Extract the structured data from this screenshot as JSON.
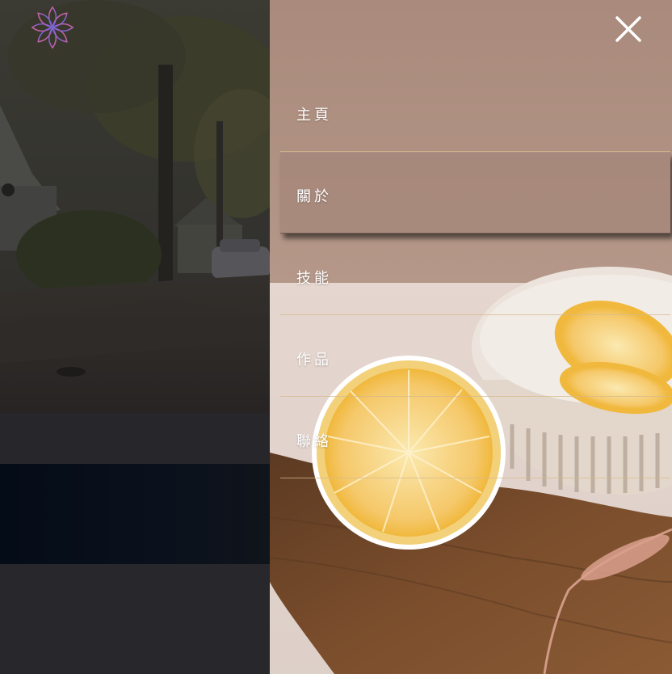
{
  "header": {
    "logo_icon": "lotus-flower-logo-icon"
  },
  "menu": {
    "close_icon": "close-icon",
    "items": [
      {
        "label": "主頁",
        "active": false
      },
      {
        "label": "關於",
        "active": true
      },
      {
        "label": "技能",
        "active": false
      },
      {
        "label": "作品",
        "active": false
      },
      {
        "label": "聯絡",
        "active": false
      }
    ]
  },
  "colors": {
    "divider": "#d6ba8c",
    "text": "#ffffff",
    "panel_wall": "#a98a7c",
    "dark_band": "#040c18",
    "page_bg": "#26262b"
  }
}
